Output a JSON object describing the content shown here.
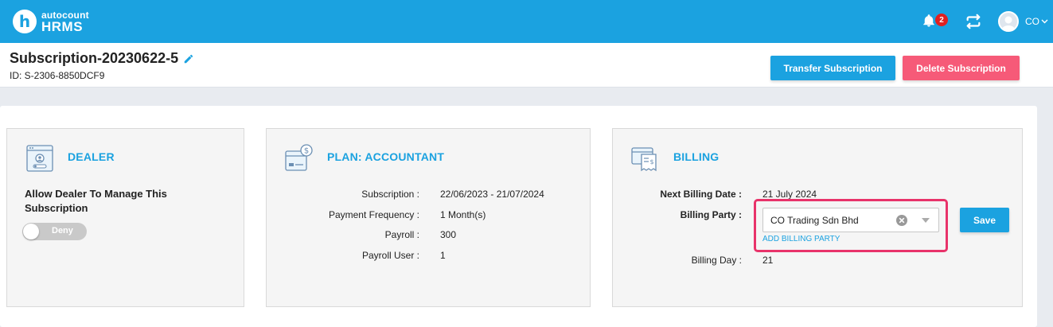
{
  "app": {
    "brand": "autocount",
    "product": "HRMS",
    "logo_letter": "h",
    "notification_count": "2",
    "user_initials": "CO"
  },
  "header": {
    "title": "Subscription-20230622-5",
    "id_text": "ID: S-2306-8850DCF9",
    "transfer_label": "Transfer Subscription",
    "delete_label": "Delete Subscription"
  },
  "dealer": {
    "title": "DEALER",
    "text": "Allow Dealer To Manage This Subscription",
    "toggle_label": "Deny"
  },
  "plan": {
    "title": "PLAN: ACCOUNTANT",
    "rows": [
      {
        "label": "Subscription :",
        "value": "22/06/2023 - 21/07/2024"
      },
      {
        "label": "Payment Frequency :",
        "value": "1 Month(s)"
      },
      {
        "label": "Payroll :",
        "value": "300"
      },
      {
        "label": "Payroll User :",
        "value": "1"
      }
    ]
  },
  "billing": {
    "title": "BILLING",
    "next_date_label": "Next Billing Date :",
    "next_date_value": "21 July 2024",
    "party_label": "Billing Party :",
    "party_value": "CO Trading Sdn Bhd",
    "add_party_label": "ADD BILLING PARTY",
    "day_label": "Billing Day :",
    "day_value": "21",
    "save_label": "Save"
  },
  "colors": {
    "primary": "#1ba2e0",
    "danger": "#f65a78",
    "highlight": "#e8336a"
  }
}
